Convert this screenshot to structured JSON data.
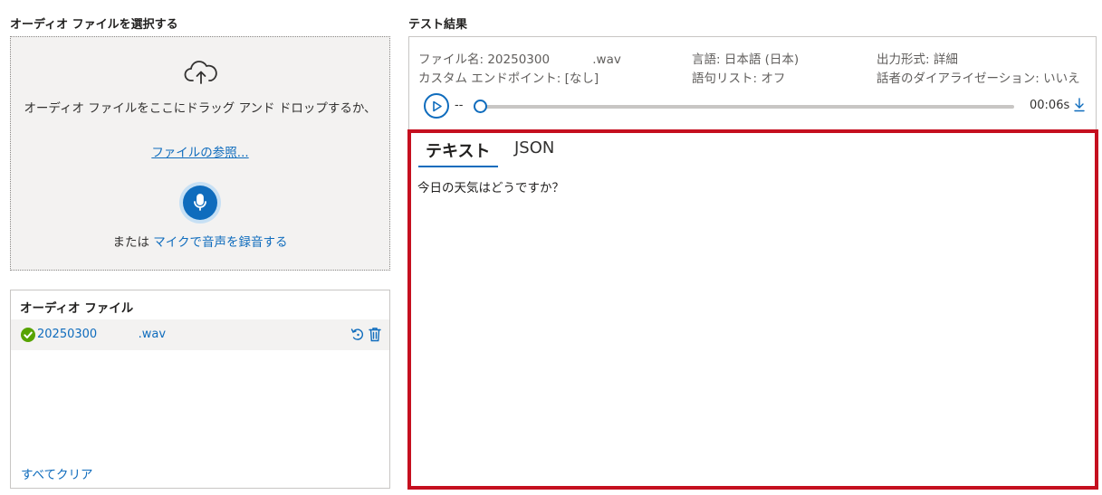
{
  "left": {
    "title": "オーディオ ファイルを選択する",
    "dropzone": {
      "icon": "cloud-upload-icon",
      "drop_text": "オーディオ ファイルをここにドラッグ アンド ドロップするか、",
      "browse_link": "ファイルの参照...",
      "mic_icon": "microphone-icon",
      "record_prefix": "または ",
      "record_link": "マイクで音声を録音する"
    },
    "files": {
      "header": "オーディオ ファイル",
      "items": [
        {
          "name": "20250300           .wav",
          "status": "success",
          "status_icon": "check-circle-icon"
        }
      ],
      "clear_all": "すべてクリア"
    }
  },
  "right": {
    "title": "テスト結果",
    "meta": {
      "file_name": "ファイル名: 20250300           .wav",
      "language": "言語: 日本語 (日本)",
      "output_format": "出力形式: 詳細",
      "custom_endpoint": "カスタム エンドポイント: [なし]",
      "phrase_list": "語句リスト: オフ",
      "diarization": "話者のダイアライゼーション: いいえ"
    },
    "player": {
      "current_time": "--",
      "duration": "00:06s",
      "progress": 0
    },
    "tabs": [
      {
        "label": "テキスト",
        "active": true
      },
      {
        "label": "JSON",
        "active": false
      }
    ],
    "transcript": "今日の天気はどうですか？"
  },
  "colors": {
    "accent": "#0f6cbd",
    "highlight_border": "#c50f1f",
    "success": "#57a300",
    "panel_bg": "#f3f2f1"
  }
}
